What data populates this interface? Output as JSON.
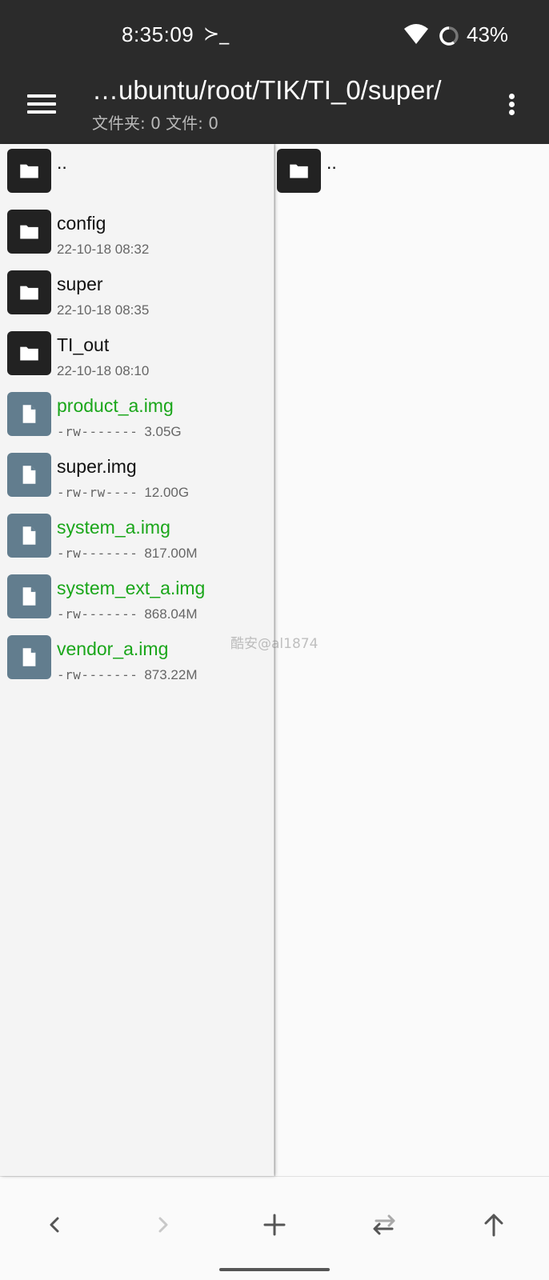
{
  "status_bar": {
    "time": "8:35:09",
    "terminal_glyph": "≻_",
    "battery": "43%"
  },
  "toolbar": {
    "path": "…ubuntu/root/TIK/TI_0/super/",
    "summary": "文件夹: 0  文件: 0"
  },
  "left_pane": {
    "parent": "..",
    "items": [
      {
        "name": "config",
        "type": "folder",
        "date": "22-10-18 08:32"
      },
      {
        "name": "super",
        "type": "folder",
        "date": "22-10-18 08:35"
      },
      {
        "name": "TI_out",
        "type": "folder",
        "date": "22-10-18 08:10"
      },
      {
        "name": "product_a.img",
        "type": "file",
        "perm": "-rw-------",
        "size": "3.05G",
        "highlight": true
      },
      {
        "name": "super.img",
        "type": "file",
        "perm": "-rw-rw----",
        "size": "12.00G",
        "highlight": false
      },
      {
        "name": "system_a.img",
        "type": "file",
        "perm": "-rw-------",
        "size": "817.00M",
        "highlight": true
      },
      {
        "name": "system_ext_a.img",
        "type": "file",
        "perm": "-rw-------",
        "size": "868.04M",
        "highlight": true
      },
      {
        "name": "vendor_a.img",
        "type": "file",
        "perm": "-rw-------",
        "size": "873.22M",
        "highlight": true
      }
    ]
  },
  "right_pane": {
    "parent": ".."
  },
  "watermark": "酷安@al1874",
  "bottom_bar": [
    "back",
    "forward",
    "add",
    "swap-panes",
    "up"
  ],
  "colors": {
    "bar": "#2b2b2b",
    "highlight": "#1aa61a",
    "folder_icon": "#222222",
    "file_icon": "#627d8e"
  }
}
